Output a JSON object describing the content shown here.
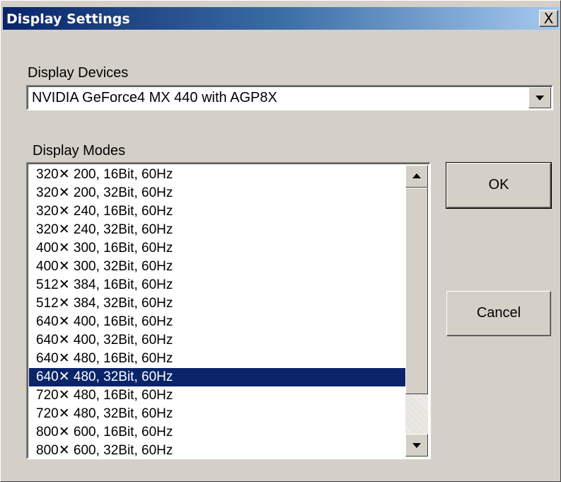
{
  "window": {
    "title": "Display Settings"
  },
  "titlebar": {
    "close_label": "X"
  },
  "devices": {
    "label": "Display Devices",
    "selected": "NVIDIA GeForce4 MX 440 with AGP8X"
  },
  "modes": {
    "label": "Display Modes",
    "selected_index": 11,
    "items": [
      "320✕ 200, 16Bit, 60Hz",
      "320✕ 200, 32Bit, 60Hz",
      "320✕ 240, 16Bit, 60Hz",
      "320✕ 240, 32Bit, 60Hz",
      "400✕ 300, 16Bit, 60Hz",
      "400✕ 300, 32Bit, 60Hz",
      "512✕ 384, 16Bit, 60Hz",
      "512✕ 384, 32Bit, 60Hz",
      "640✕ 400, 16Bit, 60Hz",
      "640✕ 400, 32Bit, 60Hz",
      "640✕ 480, 16Bit, 60Hz",
      "640✕ 480, 32Bit, 60Hz",
      "720✕ 480, 16Bit, 60Hz",
      "720✕ 480, 32Bit, 60Hz",
      "800✕ 600, 16Bit, 60Hz",
      "800✕ 600, 32Bit, 60Hz"
    ]
  },
  "buttons": {
    "ok": "OK",
    "cancel": "Cancel"
  },
  "icons": {
    "close": "close-icon",
    "combo_arrow": "chevron-down-icon",
    "scroll_up": "scroll-up-arrow-icon",
    "scroll_down": "scroll-down-arrow-icon"
  },
  "colors": {
    "dialog_face": "#d4d0c8",
    "title_gradient_start": "#0a246a",
    "title_gradient_end": "#a6caf0",
    "selection": "#0a246a"
  }
}
